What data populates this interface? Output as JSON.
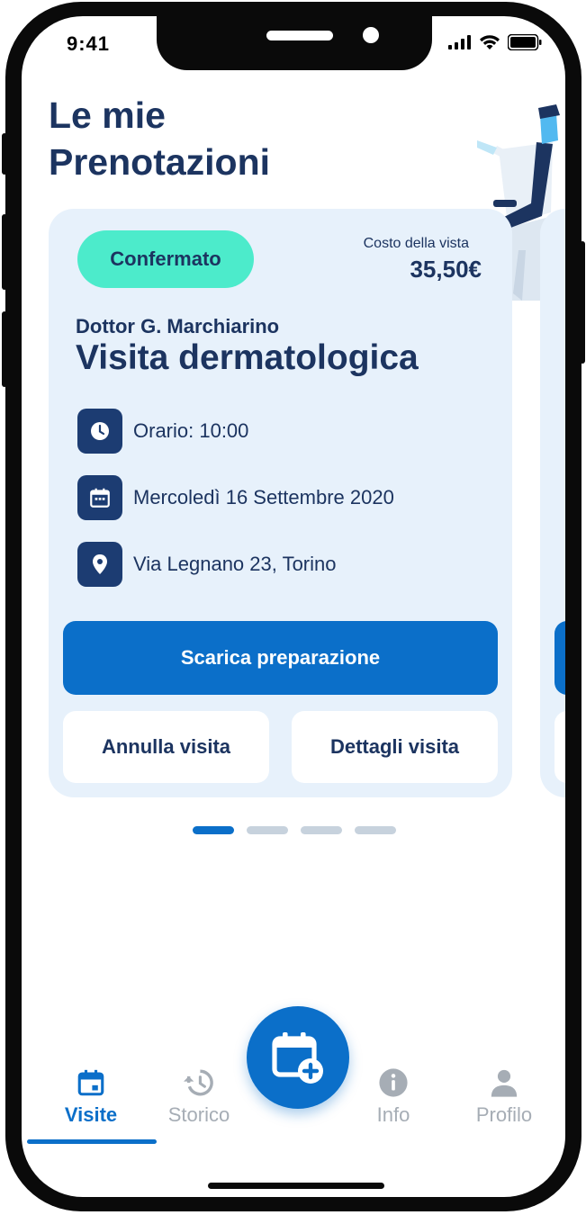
{
  "status_bar": {
    "time": "9:41"
  },
  "page": {
    "title": "Le mie\nPrenotazioni"
  },
  "booking": {
    "status": "Confermato",
    "cost_label": "Costo della vista",
    "cost_value": "35,50€",
    "doctor": "Dottor G. Marchiarino",
    "visit_type": "Visita dermatologica",
    "time": "Orario: 10:00",
    "date": "Mercoledì 16 Settembre 2020",
    "address": "Via Legnano 23, Torino",
    "primary_action": "Scarica preparazione",
    "cancel_action": "Annulla visita",
    "details_action": "Dettagli visita"
  },
  "pager": {
    "count": 4,
    "active_index": 0
  },
  "tabs": [
    {
      "label": "Visite",
      "icon": "calendar-icon",
      "active": true
    },
    {
      "label": "Storico",
      "icon": "history-icon",
      "active": false
    },
    {
      "label": "Info",
      "icon": "info-icon",
      "active": false
    },
    {
      "label": "Profilo",
      "icon": "person-icon",
      "active": false
    }
  ],
  "fab": {
    "icon": "calendar-add-icon"
  },
  "colors": {
    "primary": "#0b6fc9",
    "navy": "#1c3460",
    "status_confirmed": "#4cebcb",
    "card_bg": "#e7f1fb",
    "inactive": "#a6adb5"
  }
}
